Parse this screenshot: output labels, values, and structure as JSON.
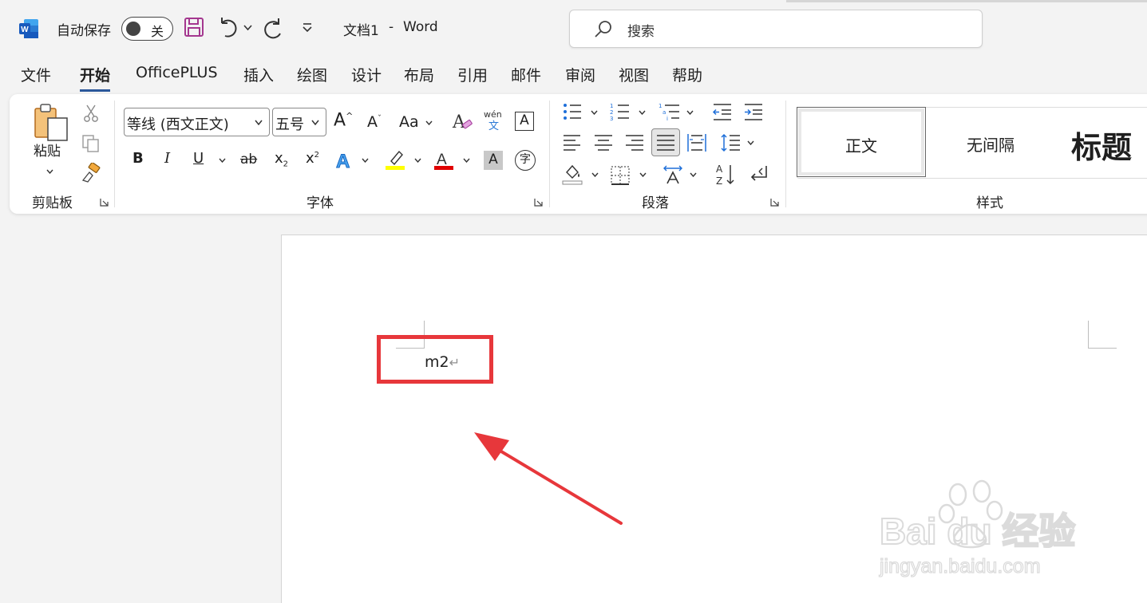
{
  "app": {
    "autosave_label": "自动保存",
    "autosave_state": "关",
    "doc_title": "文档1",
    "separator": "-",
    "app_name": "Word"
  },
  "search": {
    "placeholder": "搜索"
  },
  "tabs": [
    "文件",
    "开始",
    "OfficePLUS",
    "插入",
    "绘图",
    "设计",
    "布局",
    "引用",
    "邮件",
    "审阅",
    "视图",
    "帮助"
  ],
  "active_tab": "开始",
  "ribbon": {
    "clipboard": {
      "paste_label": "粘贴",
      "group_label": "剪贴板"
    },
    "font": {
      "font_name": "等线 (西文正文)",
      "font_size": "五号",
      "group_label": "字体",
      "bold": "B",
      "italic": "I",
      "underline": "U",
      "strike": "ab",
      "change_case": "Aa",
      "phonetic_top": "wén",
      "phonetic_bottom": "文",
      "char_border": "A",
      "enclose": "字",
      "highlight_color": "#ffff00",
      "font_color": "#e00000"
    },
    "paragraph": {
      "group_label": "段落"
    },
    "styles": {
      "group_label": "样式",
      "items": [
        "正文",
        "无间隔",
        "标题"
      ]
    }
  },
  "document": {
    "text": "m2",
    "paragraph_mark": "↵"
  },
  "colors": {
    "accent": "#2b579a",
    "annotation_red": "#e7373b"
  },
  "watermark": {
    "brand_text": "Bai du 经验",
    "url_text": "jingyan.baidu.com"
  }
}
